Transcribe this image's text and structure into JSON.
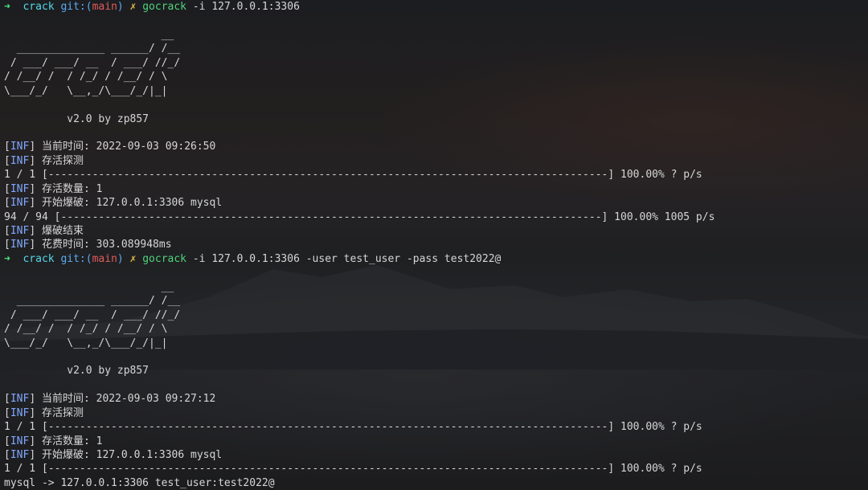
{
  "lines": [
    {
      "kind": "prompt",
      "arrow": "➜",
      "dir": "crack",
      "git": "git:(",
      "branch": "main",
      "git_end": ")",
      "x": "✗",
      "cmd": "gocrack",
      "args": "-i 127.0.0.1:3306"
    },
    {
      "kind": "text",
      "text": ""
    },
    {
      "kind": "text",
      "text": "                         __"
    },
    {
      "kind": "text",
      "text": "  ______________ ______/ /__"
    },
    {
      "kind": "text",
      "text": " / ___/ ___/ __  / ___/ //_/"
    },
    {
      "kind": "text",
      "text": "/ /__/ /  / /_/ / /__/ / \\"
    },
    {
      "kind": "text",
      "text": "\\___/_/   \\__,_/\\___/_/|_|"
    },
    {
      "kind": "text",
      "text": ""
    },
    {
      "kind": "text",
      "text": "          v2.0 by zp857"
    },
    {
      "kind": "text",
      "text": ""
    },
    {
      "kind": "inf",
      "tag": "INF",
      "text": "当前时间: 2022-09-03 09:26:50"
    },
    {
      "kind": "inf",
      "tag": "INF",
      "text": "存活探测"
    },
    {
      "kind": "text",
      "text": "1 / 1 [-----------------------------------------------------------------------------------------] 100.00% ? p/s"
    },
    {
      "kind": "inf",
      "tag": "INF",
      "text": "存活数量: 1"
    },
    {
      "kind": "inf",
      "tag": "INF",
      "text": "开始爆破: 127.0.0.1:3306 mysql"
    },
    {
      "kind": "text",
      "text": "94 / 94 [--------------------------------------------------------------------------------------] 100.00% 1005 p/s"
    },
    {
      "kind": "inf",
      "tag": "INF",
      "text": "爆破结束"
    },
    {
      "kind": "inf",
      "tag": "INF",
      "text": "花费时间: 303.089948ms"
    },
    {
      "kind": "prompt",
      "arrow": "➜",
      "dir": "crack",
      "git": "git:(",
      "branch": "main",
      "git_end": ")",
      "x": "✗",
      "cmd": "gocrack",
      "args": "-i 127.0.0.1:3306 -user test_user -pass test2022@"
    },
    {
      "kind": "text",
      "text": ""
    },
    {
      "kind": "text",
      "text": "                         __"
    },
    {
      "kind": "text",
      "text": "  ______________ ______/ /__"
    },
    {
      "kind": "text",
      "text": " / ___/ ___/ __  / ___/ //_/"
    },
    {
      "kind": "text",
      "text": "/ /__/ /  / /_/ / /__/ / \\"
    },
    {
      "kind": "text",
      "text": "\\___/_/   \\__,_/\\___/_/|_|"
    },
    {
      "kind": "text",
      "text": ""
    },
    {
      "kind": "text",
      "text": "          v2.0 by zp857"
    },
    {
      "kind": "text",
      "text": ""
    },
    {
      "kind": "inf",
      "tag": "INF",
      "text": "当前时间: 2022-09-03 09:27:12"
    },
    {
      "kind": "inf",
      "tag": "INF",
      "text": "存活探测"
    },
    {
      "kind": "text",
      "text": "1 / 1 [-----------------------------------------------------------------------------------------] 100.00% ? p/s"
    },
    {
      "kind": "inf",
      "tag": "INF",
      "text": "存活数量: 1"
    },
    {
      "kind": "inf",
      "tag": "INF",
      "text": "开始爆破: 127.0.0.1:3306 mysql"
    },
    {
      "kind": "text",
      "text": "1 / 1 [-----------------------------------------------------------------------------------------] 100.00% ? p/s"
    },
    {
      "kind": "text",
      "text": "mysql -> 127.0.0.1:3306 test_user:test2022@"
    }
  ],
  "colors": {
    "prompt_arrow": "#4fe27a",
    "dir": "#55d7e8",
    "git": "#5aa9f2",
    "branch": "#e05b5b",
    "dirty_mark": "#e2bd45",
    "command": "#4fd27a",
    "inf_tag": "#7fa7ff",
    "text": "#d6d6d6"
  }
}
